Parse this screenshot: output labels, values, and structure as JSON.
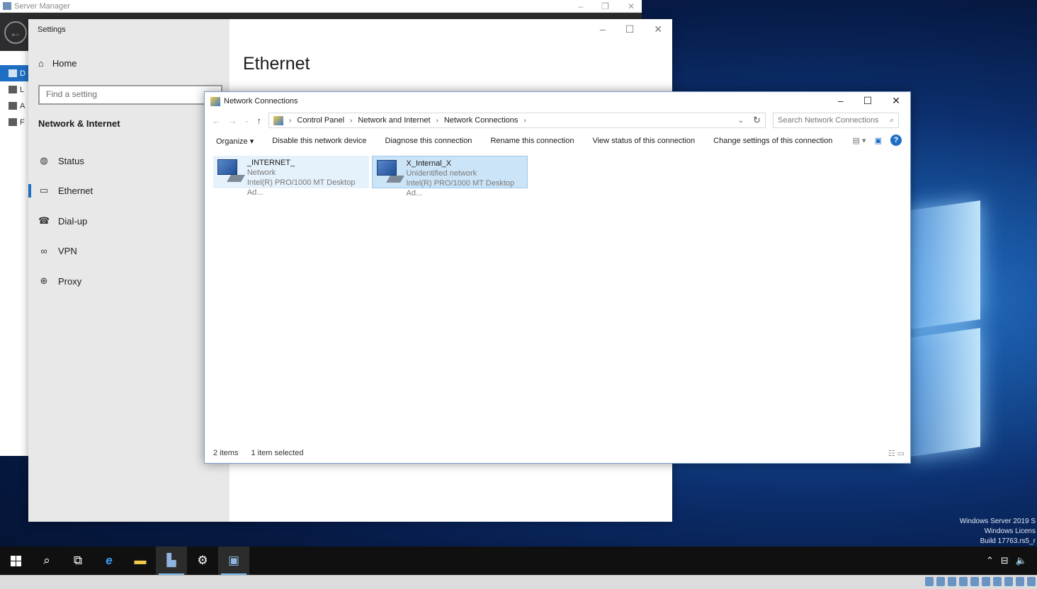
{
  "server_manager": {
    "title": "Server Manager",
    "side": [
      "D",
      "L",
      "A",
      "F"
    ]
  },
  "settings": {
    "title": "Settings",
    "home": "Home",
    "search_placeholder": "Find a setting",
    "section": "Network & Internet",
    "nav": [
      {
        "label": "Status",
        "icon": "globe-status-icon"
      },
      {
        "label": "Ethernet",
        "icon": "ethernet-icon"
      },
      {
        "label": "Dial-up",
        "icon": "dial-up-icon"
      },
      {
        "label": "VPN",
        "icon": "vpn-icon"
      },
      {
        "label": "Proxy",
        "icon": "globe-icon"
      }
    ],
    "selected": "Ethernet",
    "page_heading": "Ethernet"
  },
  "network_connections": {
    "title": "Network Connections",
    "breadcrumb": [
      "Control Panel",
      "Network and Internet",
      "Network Connections"
    ],
    "search_placeholder": "Search Network Connections",
    "commands": [
      "Organize",
      "Disable this network device",
      "Diagnose this connection",
      "Rename this connection",
      "View status of this connection",
      "Change settings of this connection"
    ],
    "items": [
      {
        "name": "_INTERNET_",
        "status": "Network",
        "adapter": "Intel(R) PRO/1000 MT Desktop Ad..."
      },
      {
        "name": "X_Internal_X",
        "status": "Unidentified network",
        "adapter": "Intel(R) PRO/1000 MT Desktop Ad..."
      }
    ],
    "status_count": "2 items",
    "status_selected": "1 item selected"
  },
  "desktop": {
    "watermark": [
      "Windows Server 2019 S",
      "Windows Licens",
      "Build 17763.rs5_r"
    ]
  },
  "taskbar": {
    "apps": [
      "start-icon",
      "search-icon",
      "task-view-icon",
      "internet-explorer-icon",
      "file-explorer-icon",
      "server-manager-icon",
      "settings-icon",
      "network-connections-icon"
    ],
    "accent": "#76b9ed"
  },
  "colors": {
    "accent": "#1e6fc4",
    "selection": "#cce4f7"
  }
}
